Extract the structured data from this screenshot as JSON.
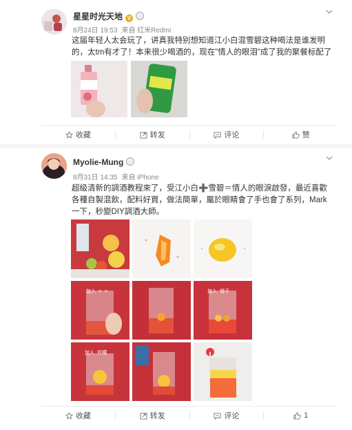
{
  "posts": [
    {
      "author": "星星时光天地",
      "verified_badge": "V",
      "time": "8月24日 19:53",
      "source": "来自 红米Redmi",
      "text": "这届年轻人太会玩了，讲真我特别想知道江小白混雪碧这种喝法是谁发明的，太tm有才了！本来很少喝酒的，现在\"情人的眼泪\"成了我的聚餐标配了",
      "actions": {
        "favorite": "收藏",
        "repost": "转发",
        "comment": "评论",
        "like": "赞"
      }
    },
    {
      "author": "Myolie-Mung",
      "time": "8月31日 14:35",
      "source": "来自 iPhone",
      "text": "超級清新的調酒教程來了，受江小白➕雪碧＝情人的眼淚啟發，最近喜歡各種自製混飲，配料好買，做法簡單，屬於眼睛會了手也會了系列，Mark一下，秒變DIY調酒大師。",
      "actions": {
        "favorite": "收藏",
        "repost": "转发",
        "comment": "评论",
        "like": "1"
      }
    }
  ],
  "icons": {
    "chevron": "chevron-down-icon",
    "favorite": "star-icon",
    "repost": "repost-icon",
    "comment": "comment-icon",
    "like": "thumbs-up-icon"
  },
  "colors": {
    "badge": "#f5a623",
    "meta": "#888888",
    "divider": "#eaeaea"
  }
}
